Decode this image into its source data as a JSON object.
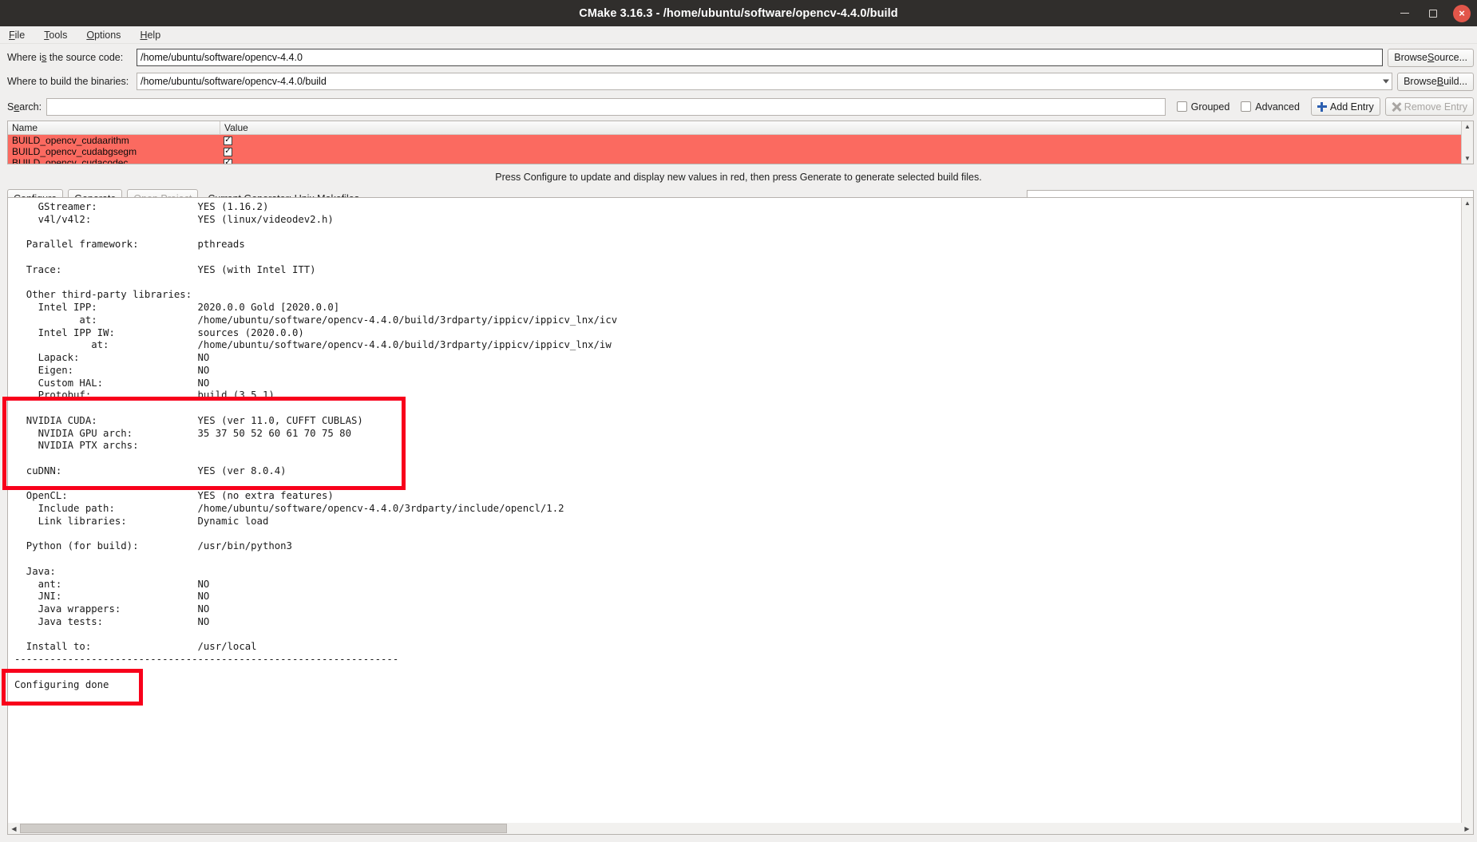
{
  "window": {
    "title": "CMake 3.16.3 - /home/ubuntu/software/opencv-4.4.0/build",
    "minimize_label": "minimize-button",
    "maximize_label": "maximize-button",
    "close_label": "×"
  },
  "menu": {
    "items": [
      {
        "label": "File",
        "mnemonic": "F",
        "rest": "ile"
      },
      {
        "label": "Tools",
        "mnemonic": "T",
        "rest": "ools"
      },
      {
        "label": "Options",
        "mnemonic": "O",
        "rest": "ptions"
      },
      {
        "label": "Help",
        "mnemonic": "H",
        "rest": "elp"
      }
    ]
  },
  "paths": {
    "source_label_pre": "Where i",
    "source_label_mn": "s",
    "source_label_post": " the source code:",
    "source_label_full": "Where is the source code:",
    "source_value": "/home/ubuntu/software/opencv-4.4.0",
    "browse_source_pre": "Browse ",
    "browse_source_mn": "S",
    "browse_source_post": "ource...",
    "build_label_full": "Where to build the binaries:",
    "build_value": "/home/ubuntu/software/opencv-4.4.0/build",
    "browse_build_pre": "Browse ",
    "browse_build_mn": "B",
    "browse_build_post": "uild..."
  },
  "search": {
    "label_pre": "S",
    "label_mn": "e",
    "label_post": "arch:",
    "label_full": "Search:",
    "value": "",
    "placeholder": "",
    "grouped_label": "Grouped",
    "grouped_checked": false,
    "advanced_label": "Advanced",
    "advanced_checked": false,
    "add_entry_label": "Add Entry",
    "remove_entry_label": "Remove Entry"
  },
  "cache_table": {
    "columns": [
      "Name",
      "Value"
    ],
    "rows": [
      {
        "name": "BUILD_opencv_cudaarithm",
        "value": "✓",
        "highlight": "#fb6a60"
      },
      {
        "name": "BUILD_opencv_cudabgsegm",
        "value": "✓",
        "highlight": "#fb6a60"
      },
      {
        "name": "BUILD_opencv_cudacodec",
        "value": "✓",
        "highlight": "#fb6a60"
      }
    ]
  },
  "message": "Press Configure to update and display new values in red, then press Generate to generate selected build files.",
  "actions": {
    "configure_pre": "",
    "configure_mn": "C",
    "configure_post": "onfigure",
    "configure_label": "Configure",
    "generate_mn": "G",
    "generate_post": "enerate",
    "generate_label": "Generate",
    "open_project_label": "Open Project",
    "open_project_disabled": true,
    "generator_label": "Current Generator: Unix Makefiles"
  },
  "console": {
    "text": "    GStreamer:                 YES (1.16.2)\n    v4l/v4l2:                  YES (linux/videodev2.h)\n\n  Parallel framework:          pthreads\n\n  Trace:                       YES (with Intel ITT)\n\n  Other third-party libraries:\n    Intel IPP:                 2020.0.0 Gold [2020.0.0]\n           at:                 /home/ubuntu/software/opencv-4.4.0/build/3rdparty/ippicv/ippicv_lnx/icv\n    Intel IPP IW:              sources (2020.0.0)\n             at:               /home/ubuntu/software/opencv-4.4.0/build/3rdparty/ippicv/ippicv_lnx/iw\n    Lapack:                    NO\n    Eigen:                     NO\n    Custom HAL:                NO\n    Protobuf:                  build (3.5.1)\n\n  NVIDIA CUDA:                 YES (ver 11.0, CUFFT CUBLAS)\n    NVIDIA GPU arch:           35 37 50 52 60 61 70 75 80\n    NVIDIA PTX archs:\n\n  cuDNN:                       YES (ver 8.0.4)\n\n  OpenCL:                      YES (no extra features)\n    Include path:              /home/ubuntu/software/opencv-4.4.0/3rdparty/include/opencl/1.2\n    Link libraries:            Dynamic load\n\n  Python (for build):          /usr/bin/python3\n\n  Java:\n    ant:                       NO\n    JNI:                       NO\n    Java wrappers:             NO\n    Java tests:                NO\n\n  Install to:                  /usr/local\n-----------------------------------------------------------------\n\nConfiguring done\n",
    "scroll_up": "▲",
    "scroll_down": "▼",
    "scroll_left": "◀",
    "scroll_right": "▶"
  },
  "annotations": {
    "cuda_box_color": "#f8001b",
    "done_box_color": "#f8001b"
  }
}
